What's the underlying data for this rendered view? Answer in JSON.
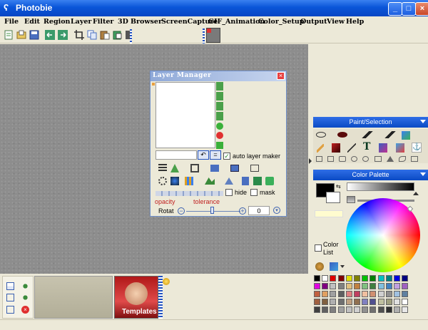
{
  "app": {
    "title": "Photobie"
  },
  "menu": [
    "File",
    "Edit",
    "Region",
    "Layer",
    "Filter",
    "3D",
    "Browser",
    "ScreenCapture",
    "GIF_Animation",
    "Color_Setup",
    "Output",
    "View",
    "Help"
  ],
  "layer_manager": {
    "title": "Layer Manager",
    "auto_layer_maker_label": "auto layer maker",
    "hide_label": "hide",
    "mask_label": "mask",
    "opacity_label": "opacity",
    "tolerance_label": "tolerance",
    "rotat_label": "Rotat",
    "rotat_value": "0",
    "auto_layer_maker_checked": true,
    "hide_checked": false,
    "mask_checked": false
  },
  "paint_panel": {
    "title": "Paint/Selection"
  },
  "color_palette": {
    "title": "Color Palette",
    "color_list_label": "Color List",
    "foreground": "#000000",
    "background": "#ffffff",
    "swatch_rows": [
      [
        "#000000",
        "#ffffff",
        "#e00000",
        "#800000",
        "#e0e000",
        "#808000",
        "#00c000",
        "#008000",
        "#00c0c0",
        "#008080",
        "#0000e0",
        "#000080"
      ],
      [
        "#e000e0",
        "#800080",
        "#c0c0c0",
        "#808080",
        "#e0c080",
        "#c08040",
        "#80c080",
        "#408040",
        "#80c0e0",
        "#4080c0",
        "#c0a0e0",
        "#a060c0"
      ],
      [
        "#c06040",
        "#e0a060",
        "#a0a0a0",
        "#606060",
        "#e08080",
        "#c04060",
        "#f0c0a0",
        "#d09070",
        "#d0d0d0",
        "#909090",
        "#a0c0e0",
        "#6080a0"
      ],
      [
        "#a06040",
        "#806040",
        "#b0b0b0",
        "#707070",
        "#c0a080",
        "#907050",
        "#8080c0",
        "#505090",
        "#c0c0a0",
        "#a0a080",
        "#e0e0e0",
        "#ffffff"
      ],
      [
        "#404040",
        "#606060",
        "#808080",
        "#a0a0a0",
        "#c0c0c0",
        "#d0d0d0",
        "#909090",
        "#707070",
        "#505050",
        "#303030",
        "#b0b0b0",
        "#e8e8e8"
      ]
    ]
  },
  "bottom": {
    "templates_label": "Templates"
  }
}
